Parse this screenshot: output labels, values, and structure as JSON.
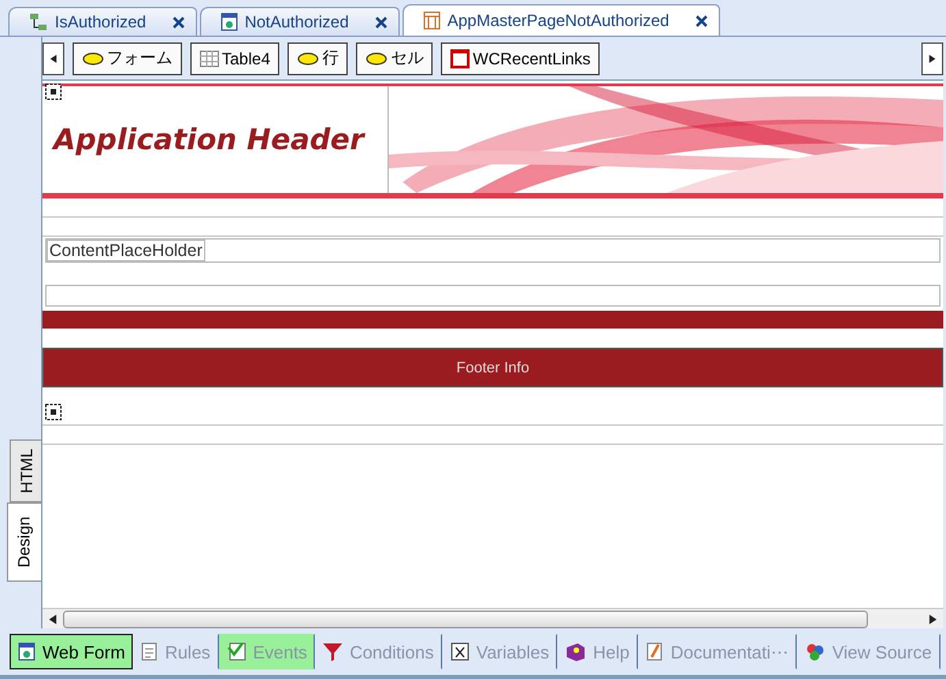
{
  "doc_tabs": [
    {
      "label": "IsAuthorized",
      "selected": false
    },
    {
      "label": "NotAuthorized",
      "selected": false
    },
    {
      "label": "AppMasterPageNotAuthorized",
      "selected": true
    }
  ],
  "toolbar": [
    {
      "label": "フォーム"
    },
    {
      "label": "Table4"
    },
    {
      "label": "行"
    },
    {
      "label": "セル"
    },
    {
      "label": "WCRecentLinks"
    }
  ],
  "canvas": {
    "header_title": "Application Header",
    "placeholder_label": "ContentPlaceHolder",
    "footer_text": "Footer Info"
  },
  "view_tabs": [
    {
      "label": "HTML",
      "selected": false
    },
    {
      "label": "Design",
      "selected": true
    }
  ],
  "bottom_tabs": [
    {
      "label": "Web Form",
      "selected": true,
      "highlighted": true
    },
    {
      "label": "Rules",
      "selected": false,
      "highlighted": false
    },
    {
      "label": "Events",
      "selected": false,
      "highlighted": true
    },
    {
      "label": "Conditions",
      "selected": false,
      "highlighted": false
    },
    {
      "label": "Variables",
      "selected": false,
      "highlighted": false
    },
    {
      "label": "Help",
      "selected": false,
      "highlighted": false
    },
    {
      "label": "Documentati⋯",
      "selected": false,
      "highlighted": false
    },
    {
      "label": "View Source",
      "selected": false,
      "highlighted": false
    }
  ]
}
